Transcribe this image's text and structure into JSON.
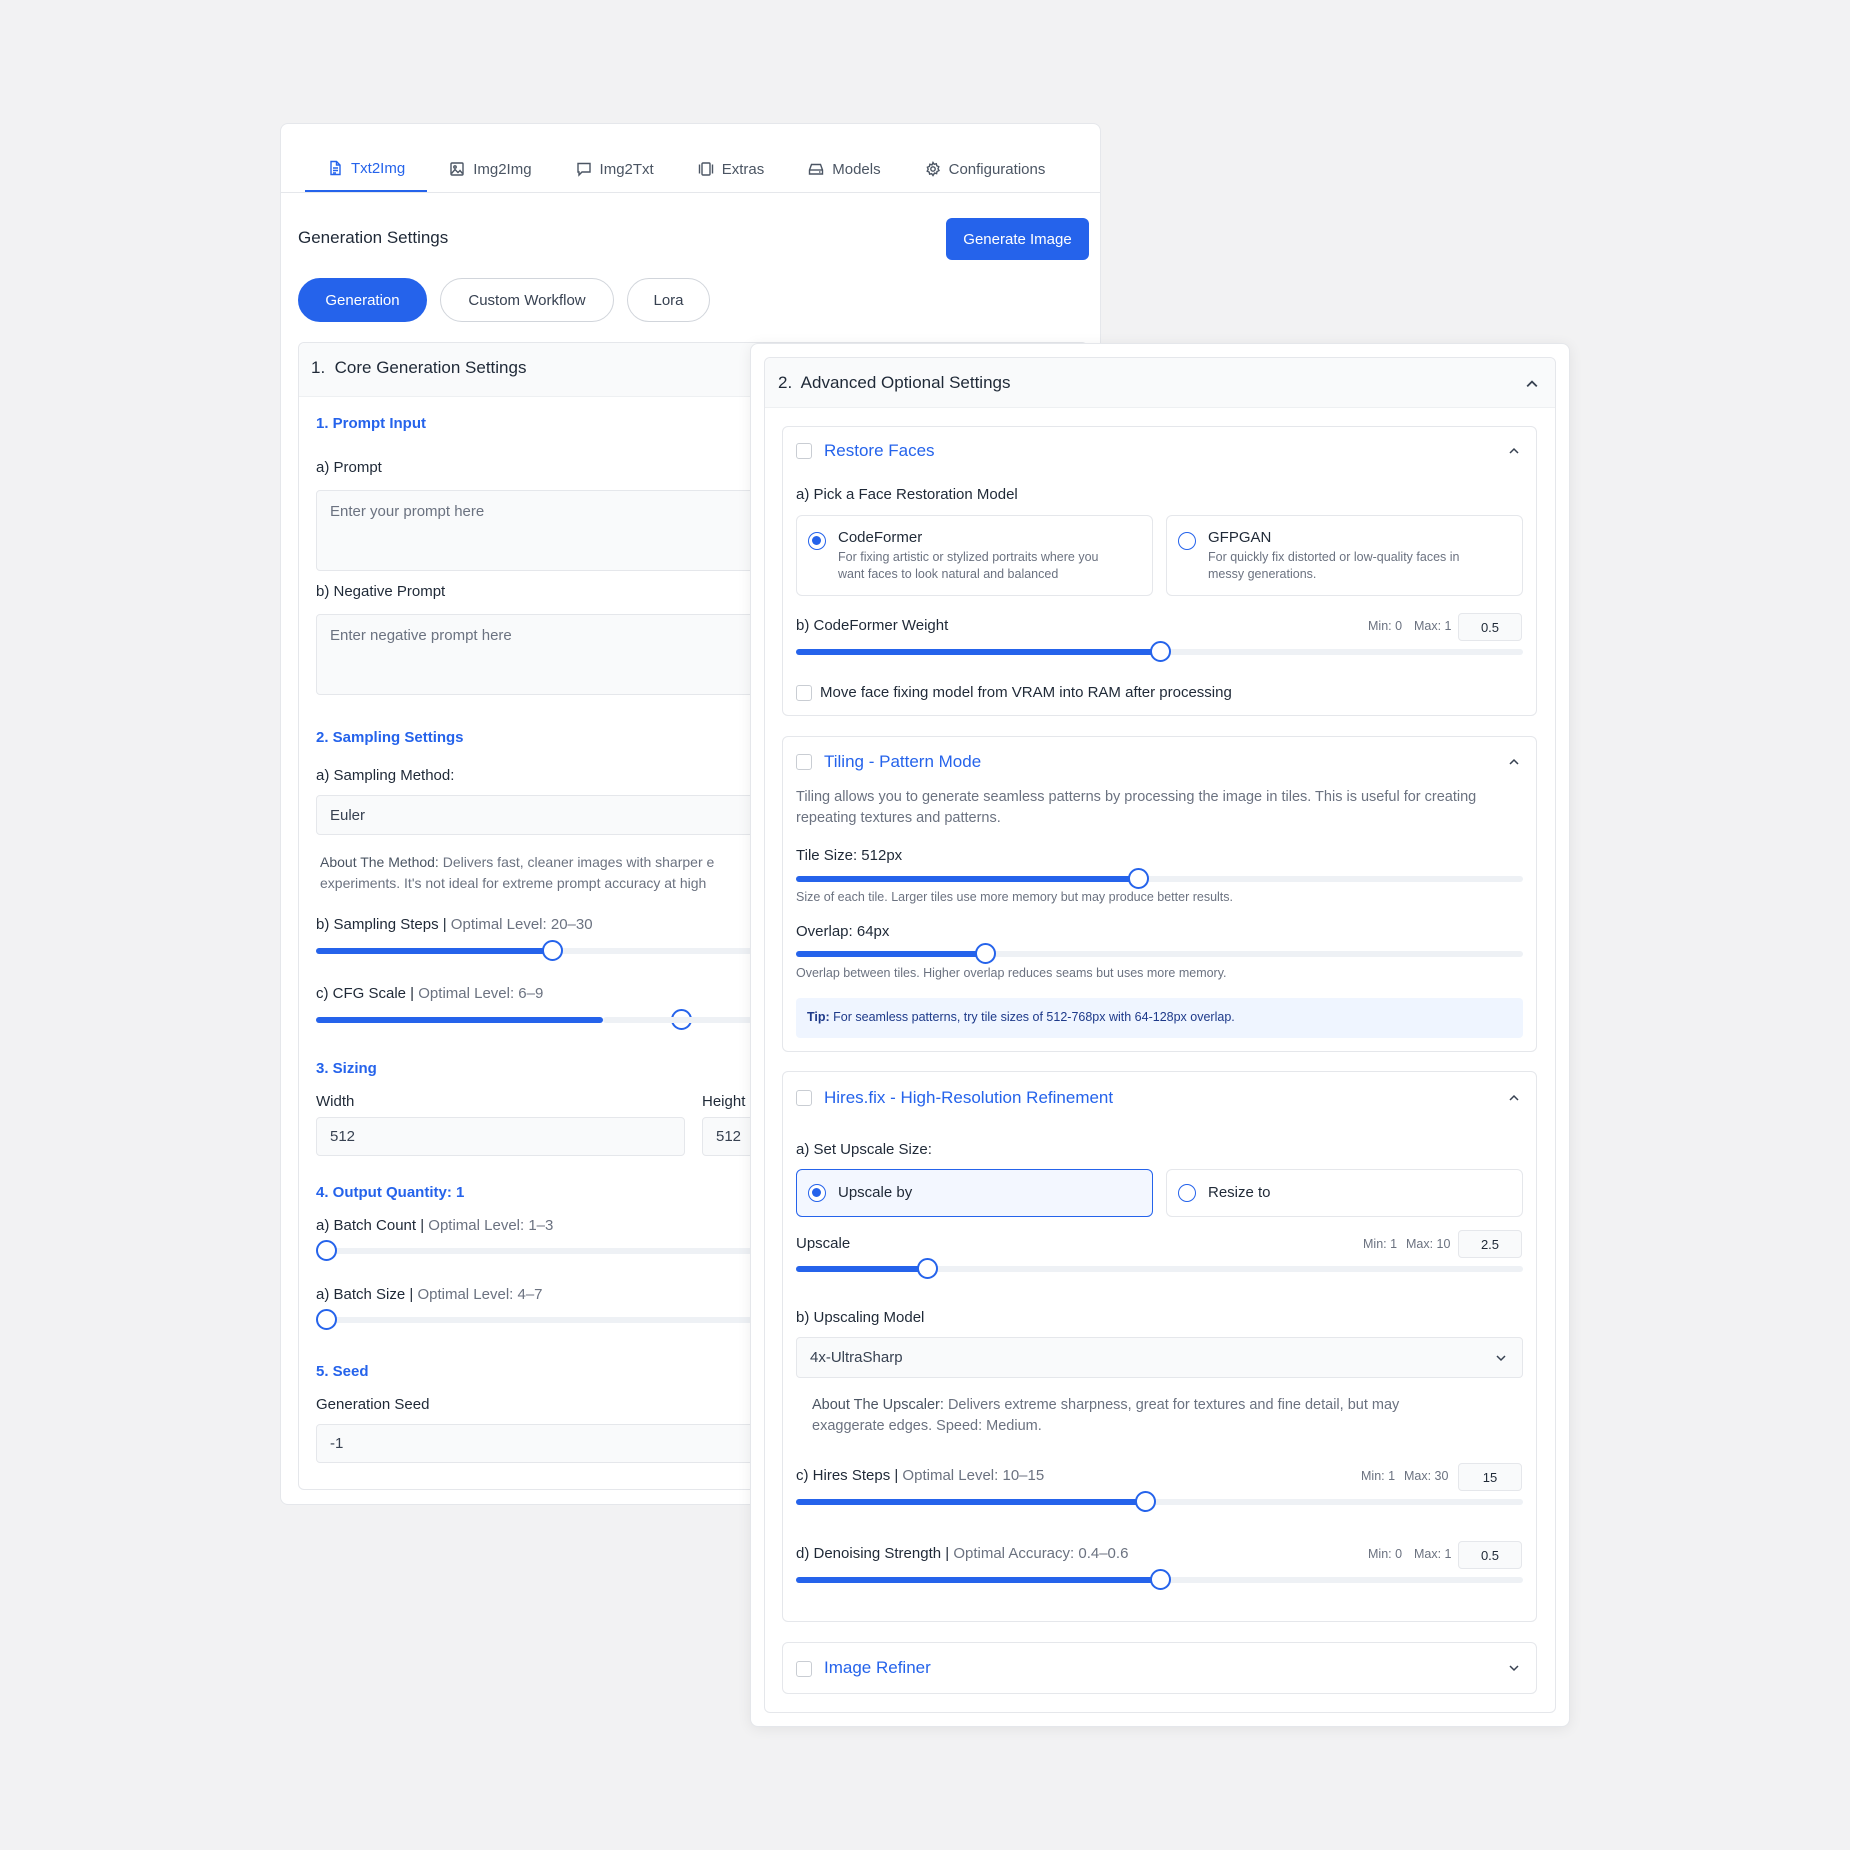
{
  "tabs": [
    {
      "label": "Txt2Img",
      "icon": "document-icon"
    },
    {
      "label": "Img2Img",
      "icon": "image-icon"
    },
    {
      "label": "Img2Txt",
      "icon": "chat-icon"
    },
    {
      "label": "Extras",
      "icon": "frames-icon"
    },
    {
      "label": "Models",
      "icon": "drive-icon"
    },
    {
      "label": "Configurations",
      "icon": "gear-icon"
    }
  ],
  "header": {
    "title": "Generation Settings",
    "generate_button": "Generate Image"
  },
  "subtabs": [
    "Generation",
    "Custom Workflow",
    "Lora"
  ],
  "core": {
    "title": "1.  Core Generation Settings",
    "prompt_section": "1. Prompt Input",
    "prompt_label": "a) Prompt",
    "prompt_placeholder": "Enter your prompt here",
    "negative_label": "b) Negative Prompt",
    "negative_placeholder": "Enter negative prompt here",
    "sampling_section": "2. Sampling Settings",
    "method_label": "a) Sampling Method:",
    "method_value": "Euler",
    "about_prefix": "About The Method:",
    "about_line1": " Delivers fast, cleaner images with sharper e",
    "about_line2": "experiments. It's not ideal for extreme prompt accuracy at high",
    "steps_label": "b) Sampling Steps |",
    "steps_hint": " Optimal Level: 20–30",
    "steps_fraction": 0.31,
    "cfg_label": "c) CFG Scale |",
    "cfg_hint": " Optimal Level: 6–9",
    "cfg_fraction": 0.48,
    "sizing_section": "3. Sizing",
    "width_label": "Width",
    "width_value": "512",
    "height_label": "Height",
    "height_value": "512",
    "quantity_section": "4. Output Quantity: 1",
    "batch_count_label": "a) Batch Count |",
    "batch_count_hint": " Optimal Level: 1–3",
    "batch_size_label": "a) Batch Size |",
    "batch_size_hint": " Optimal Level: 4–7",
    "seed_section": "5. Seed",
    "seed_label": "Generation Seed",
    "seed_value": "-1"
  },
  "advanced": {
    "title": "2.  Advanced Optional Settings",
    "restore": {
      "title": "Restore Faces",
      "model_label": "a) Pick a Face Restoration Model",
      "options": [
        {
          "name": "CodeFormer",
          "desc1": "For fixing artistic or stylized portraits where you",
          "desc2": "want faces to look natural and balanced",
          "selected": true
        },
        {
          "name": "GFPGAN",
          "desc1": "For quickly fix distorted or low-quality faces in",
          "desc2": "messy generations.",
          "selected": false
        }
      ],
      "weight_label": "b) CodeFormer Weight",
      "weight_min": "Min: 0",
      "weight_max": "Max: 1",
      "weight_value": "0.5",
      "weight_fraction": 0.5,
      "move_label": "Move face fixing model from VRAM into RAM after processing"
    },
    "tiling": {
      "title": "Tiling - Pattern Mode",
      "desc1": "Tiling allows you to generate seamless patterns by processing the image in tiles. This is useful for creating",
      "desc2": "repeating textures and patterns.",
      "tile_label": "Tile Size: 512px",
      "tile_fraction": 0.47,
      "tile_help": "Size of each tile. Larger tiles use more memory but may produce better results.",
      "overlap_label": "Overlap: 64px",
      "overlap_fraction": 0.26,
      "overlap_help": "Overlap between tiles. Higher overlap reduces seams but uses more memory.",
      "tip_prefix": "Tip:",
      "tip_text": " For seamless patterns, try tile sizes of 512-768px with 64-128px overlap."
    },
    "hires": {
      "title": "Hires.fix - High-Resolution Refinement",
      "upscale_size_label": "a) Set Upscale Size:",
      "upscale_by": "Upscale by",
      "resize_to": "Resize to",
      "upscale_label": "Upscale",
      "upscale_min": "Min: 1",
      "upscale_max": "Max: 10",
      "upscale_value": "2.5",
      "upscale_fraction": 0.18,
      "model_label": "b) Upscaling Model",
      "model_value": "4x-UltraSharp",
      "about_prefix": "About The Upscaler:",
      "about_line1": " Delivers extreme sharpness, great for textures and fine detail, but may",
      "about_line2": "exaggerate edges. Speed: Medium.",
      "steps_label": "c) Hires Steps |",
      "steps_hint": " Optimal Level: 10–15",
      "steps_min": "Min: 1",
      "steps_max": "Max: 30",
      "steps_value": "15",
      "steps_fraction": 0.48,
      "denoise_label": "d) Denoising Strength |",
      "denoise_hint": " Optimal Accuracy: 0.4–0.6",
      "denoise_min": "Min: 0",
      "denoise_max": "Max: 1",
      "denoise_value": "0.5",
      "denoise_fraction": 0.5
    },
    "refiner": {
      "title": "Image Refiner"
    }
  },
  "colors": {
    "accent": "#2563eb",
    "background": "#f2f2f3"
  }
}
